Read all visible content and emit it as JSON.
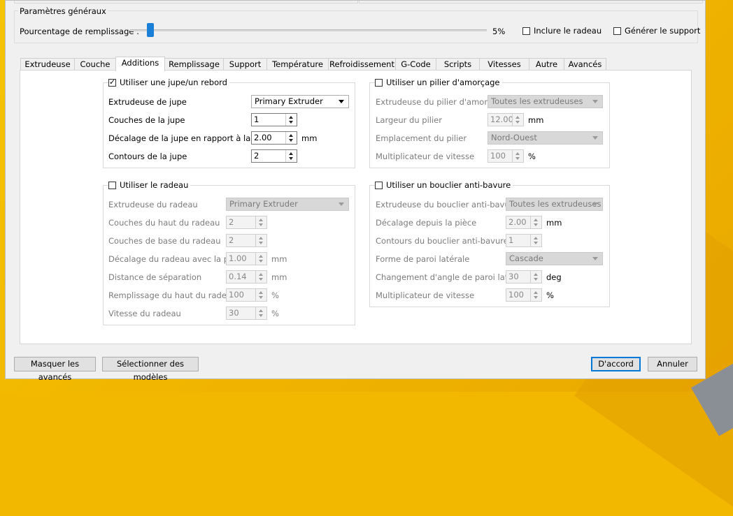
{
  "general": {
    "title": "Paramètres généraux",
    "fill_label": "Pourcentage de remplissage :",
    "fill_value": "5%",
    "fill_fraction": 0.05,
    "include_raft": "Inclure le radeau",
    "generate_support": "Générer le support"
  },
  "tabs": [
    "Extrudeuse",
    "Couche",
    "Additions",
    "Remplissage",
    "Support",
    "Température",
    "Refroidissement",
    "G-Code",
    "Scripts",
    "Vitesses",
    "Autre",
    "Avancés"
  ],
  "active_tab": "Additions",
  "skirt": {
    "title": "Utiliser une jupe/un rebord",
    "extruder_label": "Extrudeuse de jupe",
    "extruder_value": "Primary Extruder",
    "layers_label": "Couches de la jupe",
    "layers_value": "1",
    "offset_label": "Décalage de la jupe en rapport à la pièce",
    "offset_value": "2.00",
    "offset_unit": "mm",
    "outlines_label": "Contours de la jupe",
    "outlines_value": "2"
  },
  "prime": {
    "title": "Utiliser un pilier d'amorçage",
    "extruder_label": "Extrudeuse du pilier d'amorçage",
    "extruder_value": "Toutes les extrudeuses",
    "width_label": "Largeur du pilier",
    "width_value": "12.00",
    "width_unit": "mm",
    "location_label": "Emplacement du pilier",
    "location_value": "Nord-Ouest",
    "speed_label": "Multiplicateur de vitesse",
    "speed_value": "100",
    "speed_unit": "%"
  },
  "raft": {
    "title": "Utiliser le radeau",
    "extruder_label": "Extrudeuse du radeau",
    "extruder_value": "Primary Extruder",
    "top_layers_label": "Couches du haut du radeau",
    "top_layers_value": "2",
    "base_layers_label": "Couches de base du radeau",
    "base_layers_value": "2",
    "offset_label": "Décalage du radeau avec la pièce",
    "offset_value": "1.00",
    "offset_unit": "mm",
    "separation_label": "Distance de séparation",
    "separation_value": "0.14",
    "separation_unit": "mm",
    "top_infill_label": "Remplissage du haut du radeau",
    "top_infill_value": "100",
    "top_infill_unit": "%",
    "speed_label": "Vitesse du radeau",
    "speed_value": "30",
    "speed_unit": "%"
  },
  "ooze": {
    "title": "Utiliser un bouclier anti-bavure",
    "extruder_label": "Extrudeuse du bouclier anti-bavure",
    "extruder_value": "Toutes les extrudeuses",
    "offset_label": "Décalage depuis la pièce",
    "offset_value": "2.00",
    "offset_unit": "mm",
    "outlines_label": "Contours du bouclier anti-bavure",
    "outlines_value": "1",
    "wall_shape_label": "Forme de paroi latérale",
    "wall_shape_value": "Cascade",
    "angle_label": "Changement d'angle de paroi latérale",
    "angle_value": "30",
    "angle_unit": "deg",
    "speed_label": "Multiplicateur de vitesse",
    "speed_value": "100",
    "speed_unit": "%"
  },
  "footer": {
    "hide_advanced": "Masquer les avancés",
    "select_models": "Sélectionner des modèles",
    "ok": "D'accord",
    "cancel": "Annuler"
  }
}
